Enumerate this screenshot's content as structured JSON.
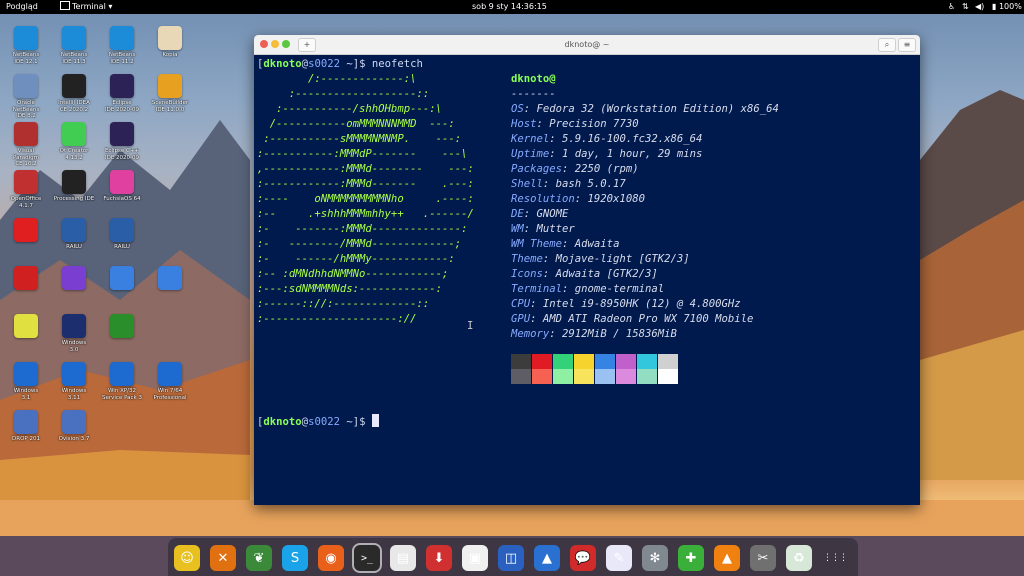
{
  "topbar": {
    "left_app": "Podgląd",
    "terminal_menu": "Terminal ▾",
    "clock": "sob 9 sty  14:36:15",
    "battery": "100%"
  },
  "desktop_icons": [
    {
      "label": "NetBeans\nIDE 12.1",
      "color": "#1c8bd8",
      "icon": "netbeans-icon"
    },
    {
      "label": "NetBeans\nIDE 11.3",
      "color": "#1c8bd8",
      "icon": "netbeans-icon"
    },
    {
      "label": "NetBeans\nIDE 11.2",
      "color": "#1c8bd8",
      "icon": "netbeans-icon"
    },
    {
      "label": "Kopia",
      "color": "#e8d8b8",
      "icon": "file-icon"
    },
    {
      "label": "Oracle NetBeans\nIDE 8.2",
      "color": "#6f8fbf",
      "icon": "netbeans-icon"
    },
    {
      "label": "IntelliJ IDEA\nCE 2020.2",
      "color": "#222222",
      "icon": "intellij-icon"
    },
    {
      "label": "Eclipse\nIDE 2020-09",
      "color": "#2c2255",
      "icon": "eclipse-icon"
    },
    {
      "label": "SceneBuilder\nIDE 11.0.0",
      "color": "#e8a020",
      "icon": "scenebuilder-icon"
    },
    {
      "label": "Visual Paradigm\nCE 16.2",
      "color": "#b03030",
      "icon": "visual-paradigm-icon"
    },
    {
      "label": "Qt Creator\n4.13.2",
      "color": "#41cd52",
      "icon": "qt-icon"
    },
    {
      "label": "Eclipse C++\nIDE 2020-09",
      "color": "#2c2255",
      "icon": "eclipse-cpp-icon"
    },
    {
      "label": "",
      "color": "#00000000",
      "icon": "empty"
    },
    {
      "label": "OpenOffice\n4.1.7",
      "color": "#c03030",
      "icon": "openoffice-icon"
    },
    {
      "label": "Processing IDE",
      "color": "#222222",
      "icon": "processing-icon"
    },
    {
      "label": "FuchsiaOS 64",
      "color": "#e040a0",
      "icon": "fuchsia-icon"
    },
    {
      "label": "",
      "color": "#00000000",
      "icon": "empty"
    },
    {
      "label": "",
      "color": "#e02020",
      "icon": "app-icon"
    },
    {
      "label": "RAILU",
      "color": "#2a5fa8",
      "icon": "railu-icon"
    },
    {
      "label": "RAILU",
      "color": "#2a5fa8",
      "icon": "railu-icon"
    },
    {
      "label": "",
      "color": "#00000000",
      "icon": "empty"
    },
    {
      "label": "",
      "color": "#d02020",
      "icon": "atari-icon"
    },
    {
      "label": "",
      "color": "#7a3fd0",
      "icon": "app-icon"
    },
    {
      "label": "",
      "color": "#3a80e0",
      "icon": "finder-icon"
    },
    {
      "label": "",
      "color": "#3a80e0",
      "icon": "finder-icon"
    },
    {
      "label": "",
      "color": "#e0e040",
      "icon": "app-icon"
    },
    {
      "label": "Windows\n3.0",
      "color": "#1c2e6e",
      "icon": "windows-icon"
    },
    {
      "label": "",
      "color": "#2a8f2a",
      "icon": "app-icon"
    },
    {
      "label": "",
      "color": "#00000000",
      "icon": "empty"
    },
    {
      "label": "Windows\n3.1",
      "color": "#1d6ad0",
      "icon": "windows-icon"
    },
    {
      "label": "Windows\n3.11",
      "color": "#1d6ad0",
      "icon": "windows-icon"
    },
    {
      "label": "Win XP/32\nService Pack 3",
      "color": "#1d6ad0",
      "icon": "windows-xp-icon"
    },
    {
      "label": "Win 7/64\nProfessional",
      "color": "#1d6ad0",
      "icon": "windows-7-icon"
    },
    {
      "label": "DROP 201",
      "color": "#4a70c0",
      "icon": "computer-icon"
    },
    {
      "label": "Ovision 3.7",
      "color": "#4a70c0",
      "icon": "computer-icon"
    }
  ],
  "terminal": {
    "title": "dknoto@ ~",
    "prompt_user": "dknoto",
    "prompt_host": "s0022",
    "prompt_path": " ~]$ ",
    "command": "neofetch",
    "art": [
      "        /:-------------:\\",
      "     :-------------------::",
      "   :-----------/shhOHbmp---:\\",
      "  /-----------omMMMNNNMMD  ---:",
      " :-----------sMMMMNMNMP.    ---:",
      ":-----------:MMMdP-------    ---\\",
      ",------------:MMMd--------    ---:",
      ":------------:MMMd-------    .---:",
      ":----    oNMMMMMMMMMNho     .----:",
      ":--     .+shhhMMMmhhy++   .------/",
      ":-    -------:MMMd--------------:",
      ":-   --------/MMMd-------------;",
      ":-    ------/hMMMy------------:",
      ":-- :dMNdhhdNMMNo------------;",
      ":---:sdNMMMMNds:------------:",
      ":------:://:-------------::",
      ":---------------------://"
    ],
    "info_user": "dknoto@",
    "info_sep": "-------",
    "info": [
      {
        "key": "OS",
        "value": "Fedora 32 (Workstation Edition) x86_64"
      },
      {
        "key": "Host",
        "value": "Precision 7730"
      },
      {
        "key": "Kernel",
        "value": "5.9.16-100.fc32.x86_64"
      },
      {
        "key": "Uptime",
        "value": "1 day, 1 hour, 29 mins"
      },
      {
        "key": "Packages",
        "value": "2250 (rpm)"
      },
      {
        "key": "Shell",
        "value": "bash 5.0.17"
      },
      {
        "key": "Resolution",
        "value": "1920x1080"
      },
      {
        "key": "DE",
        "value": "GNOME"
      },
      {
        "key": "WM",
        "value": "Mutter"
      },
      {
        "key": "WM Theme",
        "value": "Adwaita"
      },
      {
        "key": "Theme",
        "value": "Mojave-light [GTK2/3]"
      },
      {
        "key": "Icons",
        "value": "Adwaita [GTK2/3]"
      },
      {
        "key": "Terminal",
        "value": "gnome-terminal"
      },
      {
        "key": "CPU",
        "value": "Intel i9-8950HK (12) @ 4.800GHz"
      },
      {
        "key": "GPU",
        "value": "AMD ATI Radeon Pro WX 7100 Mobile"
      },
      {
        "key": "Memory",
        "value": "2912MiB / 15836MiB"
      }
    ],
    "palette_top": [
      "#3c3c3c",
      "#e01b24",
      "#33d17a",
      "#f6d32d",
      "#3584e4",
      "#c061cb",
      "#33c7de",
      "#d0d0d0"
    ],
    "palette_bottom": [
      "#5e5c64",
      "#f66151",
      "#8ff0a4",
      "#f8e45c",
      "#99c1f1",
      "#dc8add",
      "#93ddc2",
      "#ffffff"
    ]
  },
  "dock": [
    {
      "icon": "cheese-icon",
      "color": "#e8c020",
      "glyph": "☺"
    },
    {
      "icon": "x-app-icon",
      "color": "#e07010",
      "glyph": "✕"
    },
    {
      "icon": "leaf-icon",
      "color": "#3a8a3a",
      "glyph": "❦"
    },
    {
      "icon": "skype-icon",
      "color": "#1aa3e8",
      "glyph": "S"
    },
    {
      "icon": "firefox-icon",
      "color": "#e8601a",
      "glyph": "◉"
    },
    {
      "icon": "terminal-icon",
      "color": "#2a2a2a",
      "glyph": ">_"
    },
    {
      "icon": "document-icon",
      "color": "#e8e8e8",
      "glyph": "▤"
    },
    {
      "icon": "download-icon",
      "color": "#d03030",
      "glyph": "⬇"
    },
    {
      "icon": "files-icon",
      "color": "#f0f0f0",
      "glyph": "▣"
    },
    {
      "icon": "scanner-icon",
      "color": "#2a60c0",
      "glyph": "◫"
    },
    {
      "icon": "shark-icon",
      "color": "#2a70d0",
      "glyph": "▲"
    },
    {
      "icon": "chat-icon",
      "color": "#d02a2a",
      "glyph": "💬"
    },
    {
      "icon": "notes-icon",
      "color": "#e8e8f8",
      "glyph": "✎"
    },
    {
      "icon": "settings-icon",
      "color": "#808890",
      "glyph": "✻"
    },
    {
      "icon": "puzzle-icon",
      "color": "#3ab03a",
      "glyph": "✚"
    },
    {
      "icon": "vlc-icon",
      "color": "#f08010",
      "glyph": "▲"
    },
    {
      "icon": "tools-icon",
      "color": "#707070",
      "glyph": "✂"
    },
    {
      "icon": "trash-icon",
      "color": "#d8e8d8",
      "glyph": "♻"
    },
    {
      "icon": "apps-grid-icon",
      "color": "#00000000",
      "glyph": "⋮⋮⋮"
    }
  ]
}
